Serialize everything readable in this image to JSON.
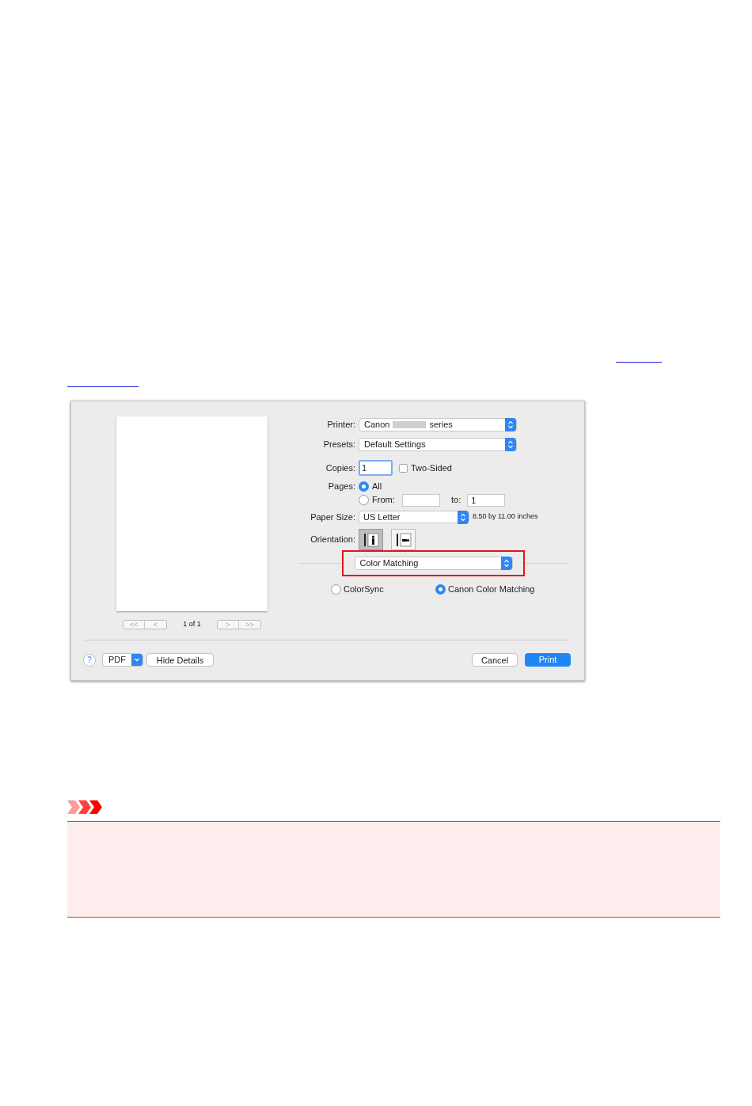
{
  "print_dialog": {
    "preview": {
      "first_glyph": "<<",
      "prev_glyph": "<",
      "page_count": "1 of 1",
      "next_glyph": ">",
      "last_glyph": ">>"
    },
    "printer": {
      "label": "Printer:",
      "value_start": "Canon",
      "value_end": "series"
    },
    "presets": {
      "label": "Presets:",
      "value": "Default Settings"
    },
    "copies": {
      "label": "Copies:",
      "value": "1",
      "two_sided": {
        "label": "Two-Sided",
        "checked": false
      }
    },
    "pages": {
      "label": "Pages:",
      "options": [
        {
          "kind": "plain",
          "label": "All",
          "selected": true
        },
        {
          "kind": "range",
          "label": "From:",
          "to_label": "to:",
          "to_value": "1",
          "selected": false
        }
      ]
    },
    "paper_size": {
      "label": "Paper Size:",
      "value": "US Letter",
      "dimensions": "8.50 by 11.00 inches"
    },
    "orientation": {
      "label": "Orientation:",
      "options": [
        {
          "kind": "portrait",
          "selected": true
        },
        {
          "kind": "landscape",
          "selected": false
        }
      ]
    },
    "section_popup": {
      "value": "Color Matching",
      "highlighted": true
    },
    "color_options": [
      {
        "label": "ColorSync",
        "selected": false
      },
      {
        "label": "Canon Color Matching",
        "selected": true
      }
    ],
    "footer": {
      "help": "?",
      "pdf": "PDF",
      "hide_details": "Hide Details",
      "cancel": "Cancel",
      "print": "Print"
    }
  }
}
